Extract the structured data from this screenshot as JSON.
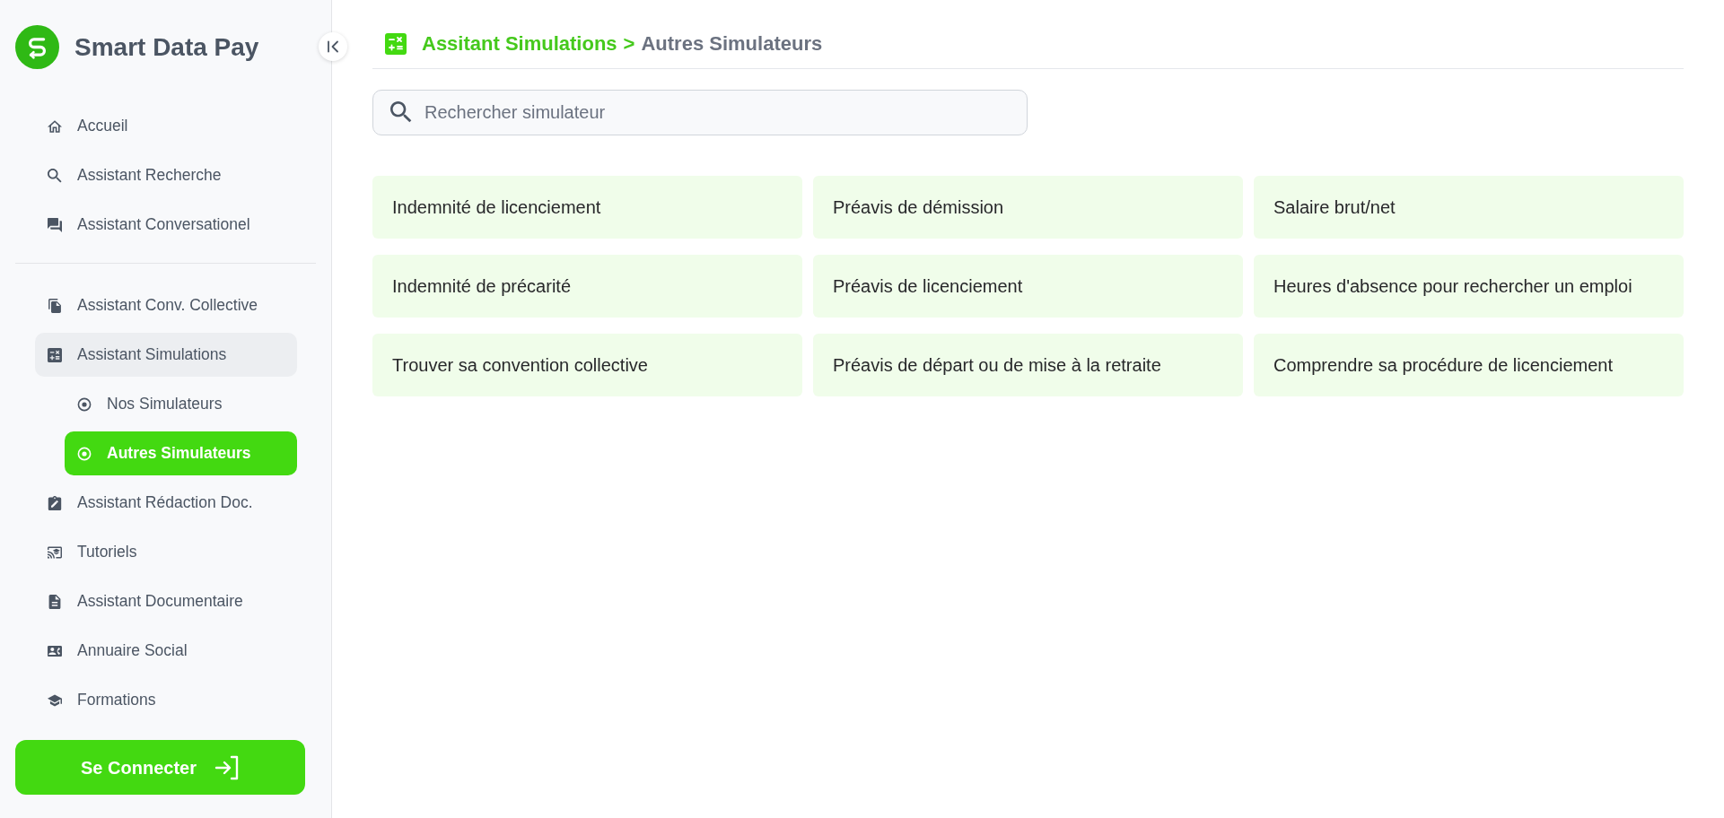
{
  "sidebar": {
    "brand": "Smart Data Pay",
    "nav_groups": [
      {
        "items": [
          {
            "label": "Accueil",
            "selected": false
          },
          {
            "label": "Assistant Recherche",
            "selected": false
          },
          {
            "label": "Assistant Conversationel",
            "selected": false
          }
        ]
      },
      {
        "items": [
          {
            "label": "Assistant Conv. Collective",
            "selected": false
          },
          {
            "label": "Assistant Simulations",
            "selected": false,
            "expanded": true,
            "children": [
              {
                "label": "Nos Simulateurs",
                "selected": false
              },
              {
                "label": "Autres Simulateurs",
                "selected": true
              }
            ]
          },
          {
            "label": "Assistant Rédaction Doc.",
            "selected": false
          },
          {
            "label": "Tutoriels",
            "selected": false
          },
          {
            "label": "Assistant Documentaire",
            "selected": false
          },
          {
            "label": "Annuaire Social",
            "selected": false
          },
          {
            "label": "Formations",
            "selected": false
          }
        ]
      }
    ],
    "login_button": "Se Connecter"
  },
  "header": {
    "breadcrumb": [
      {
        "label": "Assitant Simulations",
        "current": false
      },
      {
        "label": "Autres Simulateurs",
        "current": true
      }
    ],
    "separator": ">"
  },
  "search": {
    "placeholder": "Rechercher simulateur"
  },
  "simulators": [
    {
      "label": "Indemnité de licenciement"
    },
    {
      "label": "Préavis de démission"
    },
    {
      "label": "Salaire brut/net"
    },
    {
      "label": "Indemnité de précarité"
    },
    {
      "label": "Préavis de licenciement"
    },
    {
      "label": "Heures d'absence pour rechercher un emploi"
    },
    {
      "label": "Trouver sa convention collective"
    },
    {
      "label": "Préavis de départ ou de mise à la retraite"
    },
    {
      "label": "Comprendre sa procédure de licenciement"
    }
  ]
}
